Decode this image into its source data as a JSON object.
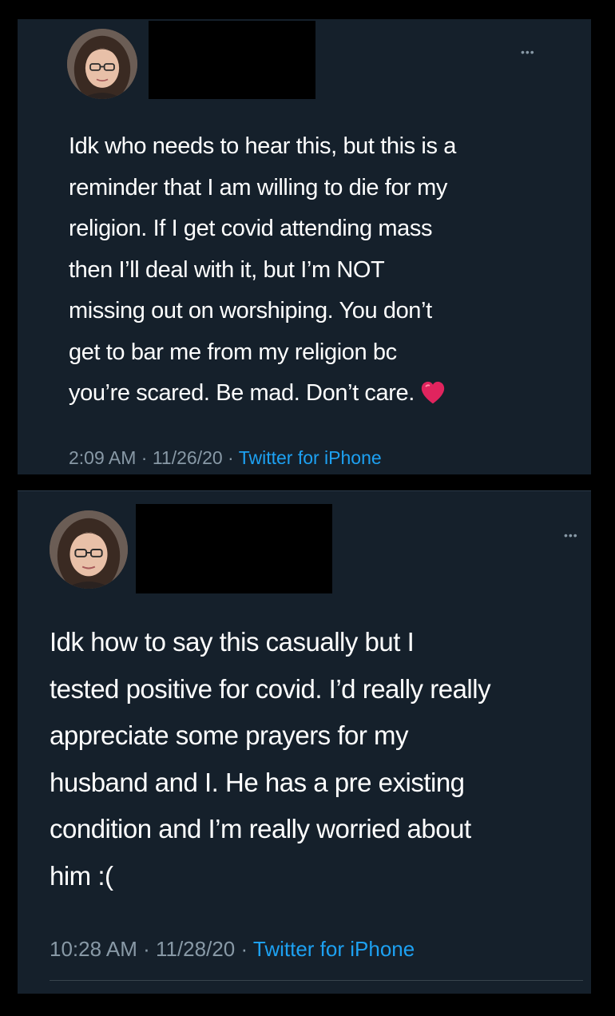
{
  "tweets": [
    {
      "more_label": "•••",
      "text_lines": [
        "Idk who needs to hear this, but this is a",
        "reminder that I am willing to die for my",
        "religion. If I get covid attending mass",
        "then I’ll deal with it, but I’m NOT",
        "missing out on worshiping. You don’t",
        "get to bar me from my religion bc",
        "you’re scared. Be mad. Don’t care."
      ],
      "emoji": "red-heart-icon",
      "time": "2:09 AM",
      "sep": " · ",
      "date": "11/26/20",
      "source": "Twitter for iPhone"
    },
    {
      "more_label": "•••",
      "text_lines": [
        "Idk how to say this casually but I",
        "tested positive for covid. I’d really really",
        "appreciate some prayers for my",
        "husband and I. He has a pre existing",
        "condition and I’m really worried about",
        "him :("
      ],
      "time": "10:28 AM",
      "sep": " · ",
      "date": "11/28/20",
      "source": "Twitter for iPhone"
    }
  ],
  "colors": {
    "background": "#000000",
    "card": "#15202b",
    "text": "#ffffff",
    "muted": "#8899a6",
    "link": "#1da1f2",
    "heart": "#e0245e"
  }
}
